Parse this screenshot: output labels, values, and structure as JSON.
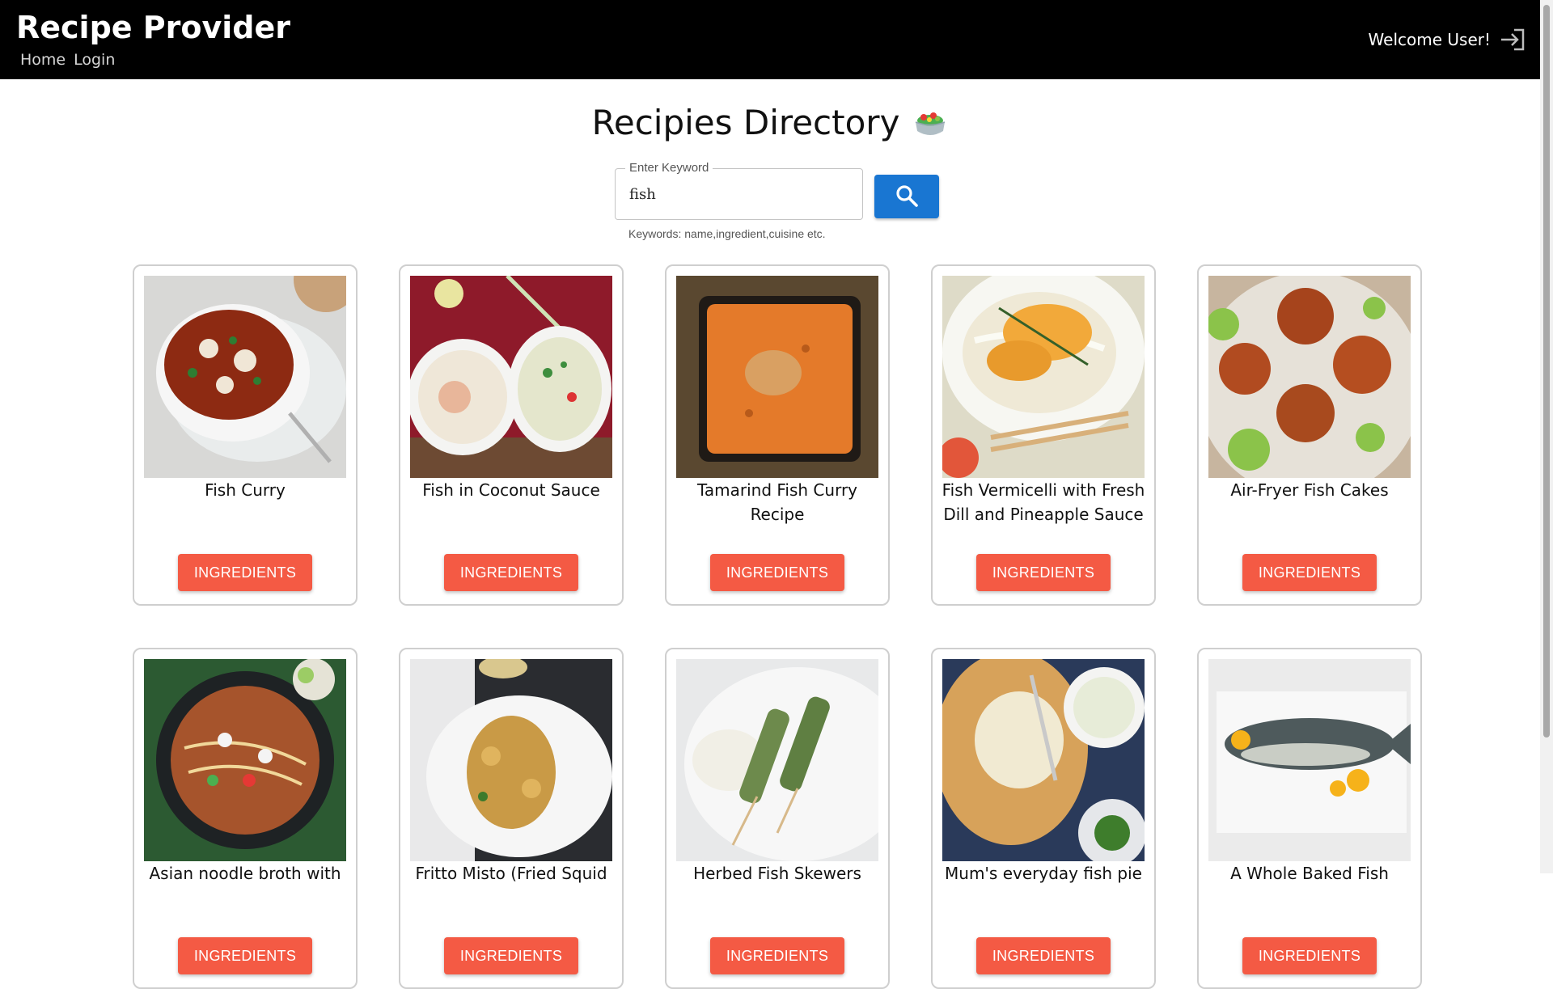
{
  "header": {
    "brand": "Recipe Provider",
    "nav": [
      {
        "label": "Home"
      },
      {
        "label": "Login"
      }
    ],
    "welcome": "Welcome User!",
    "logout_icon": "logout-arrow-icon"
  },
  "main": {
    "title": "Recipies Directory",
    "title_icon": "salad-bowl-icon",
    "search": {
      "label": "Enter Keyword",
      "value": "fish",
      "helper": "Keywords: name,ingredient,cuisine etc.",
      "button_icon": "search-icon",
      "button_color": "#1976d2"
    },
    "button_color": "#f45a44",
    "recipes": [
      {
        "title": "Fish Curry",
        "button": "INGREDIENTS"
      },
      {
        "title": "Fish in Coconut Sauce",
        "button": "INGREDIENTS"
      },
      {
        "title": "Tamarind Fish Curry Recipe",
        "button": "INGREDIENTS"
      },
      {
        "title": "Fish Vermicelli with Fresh Dill and Pineapple Sauce",
        "button": "INGREDIENTS"
      },
      {
        "title": "Air-Fryer Fish Cakes",
        "button": "INGREDIENTS"
      },
      {
        "title": "Asian noodle broth with",
        "button": "INGREDIENTS"
      },
      {
        "title": "Fritto Misto (Fried Squid",
        "button": "INGREDIENTS"
      },
      {
        "title": "Herbed Fish Skewers",
        "button": "INGREDIENTS"
      },
      {
        "title": "Mum's everyday fish pie",
        "button": "INGREDIENTS"
      },
      {
        "title": "A Whole Baked Fish",
        "button": "INGREDIENTS"
      }
    ]
  }
}
